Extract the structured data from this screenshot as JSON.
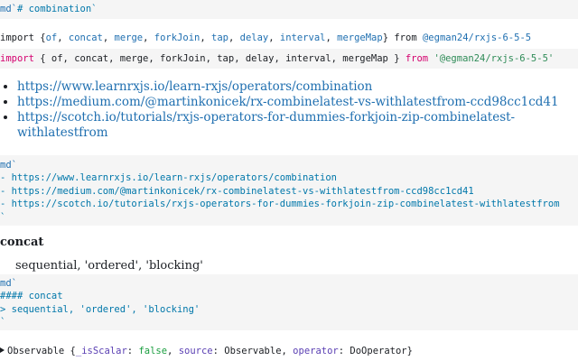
{
  "cell1": {
    "tag": "md`",
    "text": "# combination`"
  },
  "import_output": {
    "kw_import": "import",
    "open": " {",
    "items": [
      "of",
      "concat",
      "merge",
      "forkJoin",
      "tap",
      "delay",
      "interval",
      "mergeMap"
    ],
    "close": "} ",
    "kw_from": "from",
    "pkg": "@egman24/rxjs-6-5-5"
  },
  "import_source": {
    "kw_import": "import",
    "body": " { of, concat, merge, forkJoin, tap, delay, interval, mergeMap } ",
    "kw_from": "from",
    "pkg": " '@egman24/rxjs-6-5-5'"
  },
  "links": [
    "https://www.learnrxjs.io/learn-rxjs/operators/combination",
    "https://medium.com/@martinkonicek/rx-combinelatest-vs-withlatestfrom-ccd98cc1cd41",
    "https://scotch.io/tutorials/rxjs-operators-for-dummies-forkjoin-zip-combinelatest-withlatestfrom"
  ],
  "links_source": {
    "tag": "md`",
    "lines": [
      "- https://www.learnrxjs.io/learn-rxjs/operators/combination",
      "- https://medium.com/@martinkonicek/rx-combinelatest-vs-withlatestfrom-ccd98cc1cd41",
      "- https://scotch.io/tutorials/rxjs-operators-for-dummies-forkjoin-zip-combinelatest-withlatestfrom"
    ],
    "end": "`"
  },
  "concat_section": {
    "heading": "concat",
    "paragraph": "sequential, 'ordered', 'blocking'"
  },
  "concat_source": {
    "tag": "md`",
    "heading_line": "#### concat",
    "quote_line": "> sequential, 'ordered', 'blocking'",
    "end": "`"
  },
  "observable_output": {
    "name": "Observable",
    "open": " {",
    "k1": "_isScalar",
    "v1": "false",
    "k2": "source",
    "v2": "Observable",
    "k3": "operator",
    "v3": "DoOperator",
    "close": "}"
  },
  "colors": {
    "source_bg": "#f5f5f5",
    "keyword_pink": "#d4006e",
    "link_blue": "#1f6fb0",
    "key_purple": "#5a3fb3",
    "string_cyan": "#0077aa",
    "bool_green": "#1a9e3f"
  }
}
